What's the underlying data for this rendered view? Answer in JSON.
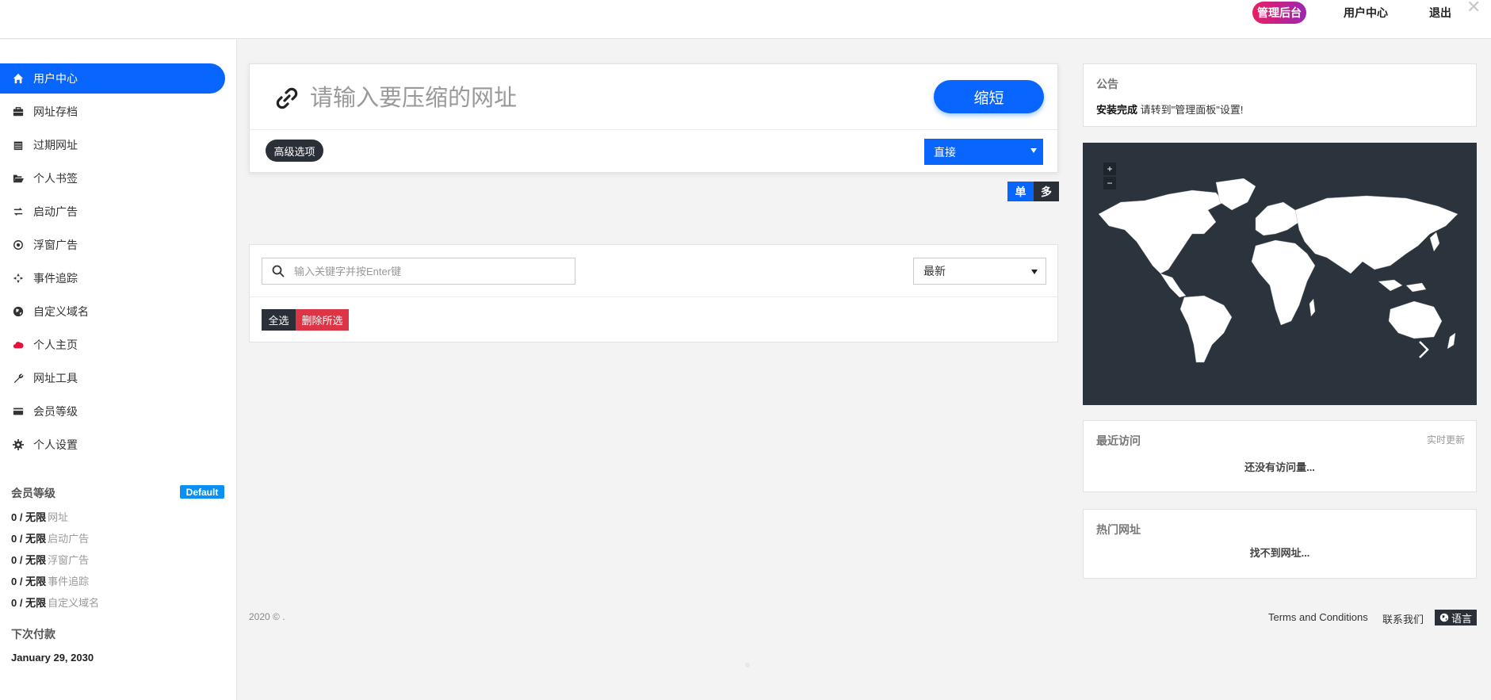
{
  "topbar": {
    "admin_label": "管理后台",
    "user_center_label": "用户中心",
    "logout_label": "退出",
    "close_symbol": "✕"
  },
  "sidebar": {
    "items": [
      {
        "label": "用户中心",
        "icon": "home-icon",
        "active": true
      },
      {
        "label": "网址存档",
        "icon": "briefcase-icon"
      },
      {
        "label": "过期网址",
        "icon": "calendar-icon"
      },
      {
        "label": "个人书签",
        "icon": "folder-open-icon"
      },
      {
        "label": "启动广告",
        "icon": "exchange-icon"
      },
      {
        "label": "浮窗广告",
        "icon": "dot-circle-icon"
      },
      {
        "label": "事件追踪",
        "icon": "crosshair-icon"
      },
      {
        "label": "自定义域名",
        "icon": "globe-icon"
      },
      {
        "label": "个人主页",
        "icon": "cloud-icon"
      },
      {
        "label": "网址工具",
        "icon": "wrench-icon"
      },
      {
        "label": "会员等级",
        "icon": "credit-card-icon"
      },
      {
        "label": "个人设置",
        "icon": "gear-icon"
      }
    ],
    "plan": {
      "heading": "会员等级",
      "badge": "Default",
      "limits": [
        {
          "count": "0 / 无限",
          "label": "网址"
        },
        {
          "count": "0 / 无限",
          "label": "启动广告"
        },
        {
          "count": "0 / 无限",
          "label": "浮窗广告"
        },
        {
          "count": "0 / 无限",
          "label": "事件追踪"
        },
        {
          "count": "0 / 无限",
          "label": "自定义域名"
        }
      ],
      "next_payment_heading": "下次付款",
      "next_payment_date": "January 29, 2030"
    }
  },
  "shorten": {
    "placeholder": "请输入要压缩的网址",
    "button_label": "缩短",
    "advanced_label": "高级选项",
    "redirect_type": "直接"
  },
  "mode_toggle": {
    "single_label": "单",
    "multi_label": "多"
  },
  "links": {
    "search_placeholder": "输入关键字并按Enter键",
    "sort_value": "最新",
    "select_all_label": "全选",
    "delete_selected_label": "删除所选"
  },
  "notice": {
    "title": "公告",
    "bold_text": "安装完成",
    "text": " 请转到\"管理面板\"设置!"
  },
  "map": {
    "zoom_in": "+",
    "zoom_out": "−"
  },
  "recent": {
    "title": "最近访问",
    "realtime_label": "实时更新",
    "empty_text": "还没有访问量..."
  },
  "popular": {
    "title": "热门网址",
    "empty_text": "找不到网址..."
  },
  "footer": {
    "copyright": "2020 © .",
    "terms_label": "Terms and Conditions",
    "contact_label": "联系我们",
    "language_label": "语言"
  },
  "colors": {
    "primary": "#0866ff",
    "dark": "#2b2f38",
    "danger": "#dc3545",
    "map_bg": "#2b333d"
  }
}
